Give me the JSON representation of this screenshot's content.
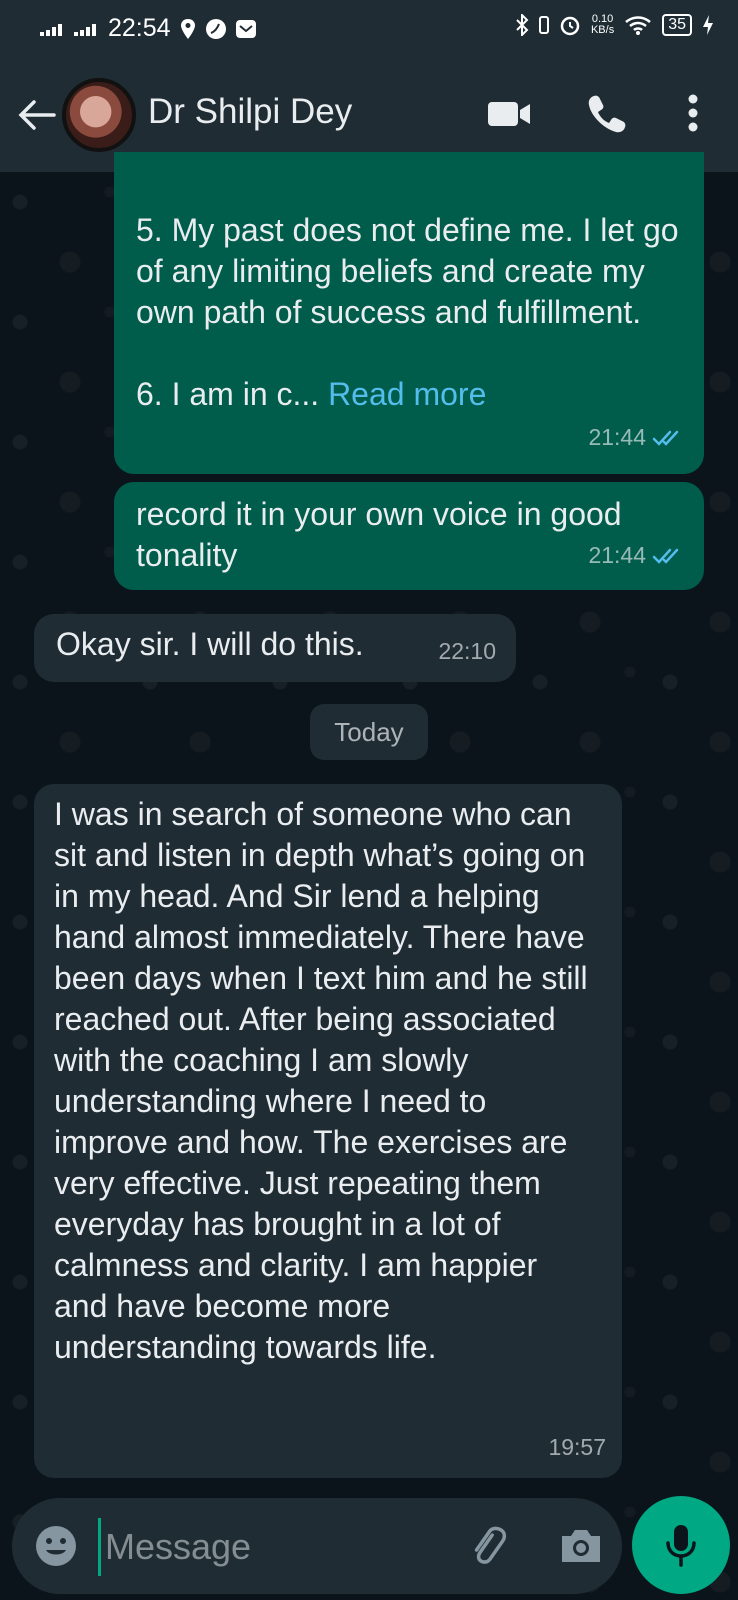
{
  "status_bar": {
    "time": "22:54",
    "net_speed_value": "0.10",
    "net_speed_unit": "KB/s",
    "battery": "35"
  },
  "header": {
    "contact_name": "Dr Shilpi Dey"
  },
  "messages": [
    {
      "direction": "outgoing",
      "text": "5. My past does not define me. I let go of any limiting beliefs and create my own path of success and fulfillment.\n\n6. I am in c... ",
      "read_more": "Read more",
      "time": "21:44",
      "status": "read"
    },
    {
      "direction": "outgoing",
      "text": "record it in your own voice in good tonality",
      "time": "21:44",
      "status": "read"
    },
    {
      "direction": "incoming",
      "text": "Okay sir. I will do this.",
      "time": "22:10"
    },
    {
      "direction": "incoming",
      "text": "I was in search of someone who can sit and listen in depth what’s going on in my head. And Sir lend a helping hand almost immediately. There have been days when I text him and he still reached out. After being associated with the coaching I am slowly understanding where I need to improve and how. The exercises are very effective. Just repeating them everyday has brought in a lot of calmness and clarity. I am happier and have become more understanding towards life.",
      "time": "19:57"
    }
  ],
  "date_divider": "Today",
  "composer": {
    "placeholder": "Message"
  },
  "colors": {
    "outgoing_bubble": "#005c4b",
    "incoming_bubble": "#1f2c34",
    "accent": "#00a884",
    "read_ticks": "#53bdeb"
  }
}
